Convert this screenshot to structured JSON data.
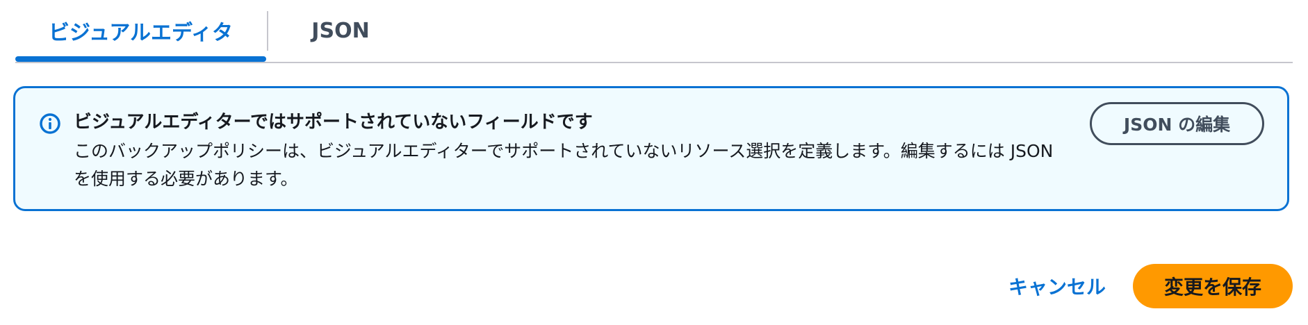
{
  "tabs": [
    {
      "label": "ビジュアルエディタ",
      "active": true
    },
    {
      "label": "JSON",
      "active": false
    }
  ],
  "alert": {
    "type": "info",
    "icon": "info-icon",
    "title": "ビジュアルエディターではサポートされていないフィールドです",
    "body": "このバックアップポリシーは、ビジュアルエディターでサポートされていないリソース選択を定義します。編集するには JSON を使用する必要があります。",
    "action_label": "JSON の編集"
  },
  "footer": {
    "cancel_label": "キャンセル",
    "save_label": "変更を保存"
  },
  "colors": {
    "accent": "#0972d3",
    "alert_background": "#f0fbff",
    "primary_button": "#ff9900",
    "secondary_text": "#414d5c"
  }
}
